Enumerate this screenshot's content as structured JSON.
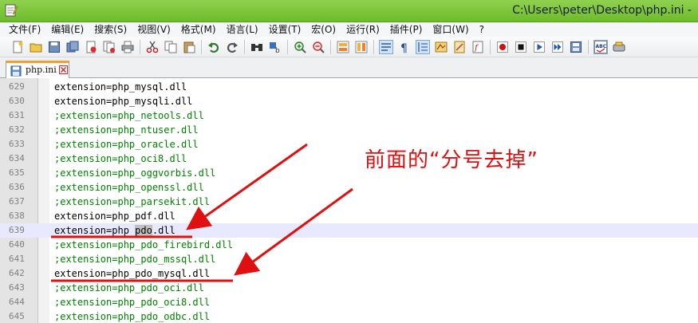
{
  "window": {
    "title": "C:\\Users\\peter\\Desktop\\php.ini -"
  },
  "menu": [
    {
      "id": "file",
      "label": "文件(F)"
    },
    {
      "id": "edit",
      "label": "编辑(E)"
    },
    {
      "id": "search",
      "label": "搜索(S)"
    },
    {
      "id": "view",
      "label": "视图(V)"
    },
    {
      "id": "format",
      "label": "格式(M)"
    },
    {
      "id": "language",
      "label": "语言(L)"
    },
    {
      "id": "settings",
      "label": "设置(T)"
    },
    {
      "id": "macro",
      "label": "宏(O)"
    },
    {
      "id": "run",
      "label": "运行(R)"
    },
    {
      "id": "plugins",
      "label": "插件(P)"
    },
    {
      "id": "window",
      "label": "窗口(W)"
    },
    {
      "id": "help",
      "label": "?"
    }
  ],
  "toolbar": {
    "groups": [
      [
        "new-file-icon",
        "open-file-icon",
        "save-icon",
        "save-all-icon",
        "close-icon",
        "close-all-icon",
        "print-icon"
      ],
      [
        "cut-icon",
        "copy-icon",
        "paste-icon"
      ],
      [
        "undo-icon",
        "redo-icon"
      ],
      [
        "find-icon",
        "replace-icon"
      ],
      [
        "zoom-in-icon",
        "zoom-out-icon"
      ],
      [
        "sync-vertical-icon",
        "sync-horizontal-icon"
      ],
      [
        "word-wrap-icon",
        "show-all-chars-icon",
        "indent-guide-icon",
        "user-language-icon",
        "doc-map-icon",
        "function-list-icon"
      ],
      [
        "record-macro-icon",
        "stop-macro-icon",
        "play-macro-icon",
        "run-macro-multiple-icon",
        "save-macro-icon"
      ],
      [
        "spell-check-icon",
        "plugin-icon"
      ]
    ],
    "active": [
      "word-wrap-icon",
      "indent-guide-icon",
      "spell-check-icon"
    ],
    "spell_label": "ABC"
  },
  "tab": {
    "label": "php.ini"
  },
  "editor": {
    "current_line": 639,
    "lines": [
      {
        "n": "629",
        "text": "extension=php_mysql.dll",
        "kind": "plain"
      },
      {
        "n": "630",
        "text": "extension=php_mysqli.dll",
        "kind": "plain"
      },
      {
        "n": "631",
        "text": ";extension=php_netools.dll",
        "kind": "comment"
      },
      {
        "n": "632",
        "text": ";extension=php_ntuser.dll",
        "kind": "comment"
      },
      {
        "n": "633",
        "text": ";extension=php_oracle.dll",
        "kind": "comment"
      },
      {
        "n": "634",
        "text": ";extension=php_oci8.dll",
        "kind": "comment"
      },
      {
        "n": "635",
        "text": ";extension=php_oggvorbis.dll",
        "kind": "comment"
      },
      {
        "n": "636",
        "text": ";extension=php_openssl.dll",
        "kind": "comment"
      },
      {
        "n": "637",
        "text": ";extension=php_parsekit.dll",
        "kind": "comment"
      },
      {
        "n": "638",
        "text": "extension=php_pdf.dll",
        "kind": "plain"
      },
      {
        "n": "639",
        "text_before": "extension=php_",
        "text_hl": "pdo",
        "text_after": ".dll",
        "kind": "plain",
        "current": true
      },
      {
        "n": "640",
        "text": ";extension=php_pdo_firebird.dll",
        "kind": "comment"
      },
      {
        "n": "641",
        "text": ";extension=php_pdo_mssql.dll",
        "kind": "comment"
      },
      {
        "n": "642",
        "text": "extension=php_pdo_mysql.dll",
        "kind": "plain"
      },
      {
        "n": "643",
        "text": ";extension=php_pdo_oci.dll",
        "kind": "comment"
      },
      {
        "n": "644",
        "text": ";extension=php_pdo_oci8.dll",
        "kind": "comment"
      },
      {
        "n": "645",
        "text": ";extension=php_pdo_odbc.dll",
        "kind": "comment"
      }
    ]
  },
  "annotation": {
    "text": "前面的“分号去掉”",
    "color": "#e01010"
  },
  "colors": {
    "titlebar": "#7cc63a",
    "comment": "#008000",
    "current_line": "#e8e8ff",
    "annotation": "#e01010"
  }
}
